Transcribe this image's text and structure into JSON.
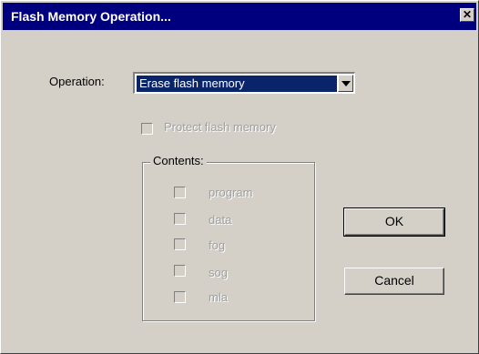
{
  "window": {
    "title": "Flash Memory Operation...",
    "close_glyph": "✕"
  },
  "operation": {
    "label": "Operation:",
    "selected": "Erase flash memory"
  },
  "protect": {
    "label": "Protect flash memory",
    "checked": false,
    "enabled": false
  },
  "contents": {
    "title": "Contents:",
    "items": [
      {
        "label": "program",
        "checked": false
      },
      {
        "label": "data",
        "checked": false
      },
      {
        "label": "fog",
        "checked": false
      },
      {
        "label": "sog",
        "checked": false
      },
      {
        "label": "mla",
        "checked": false
      }
    ]
  },
  "buttons": {
    "ok": "OK",
    "cancel": "Cancel"
  }
}
